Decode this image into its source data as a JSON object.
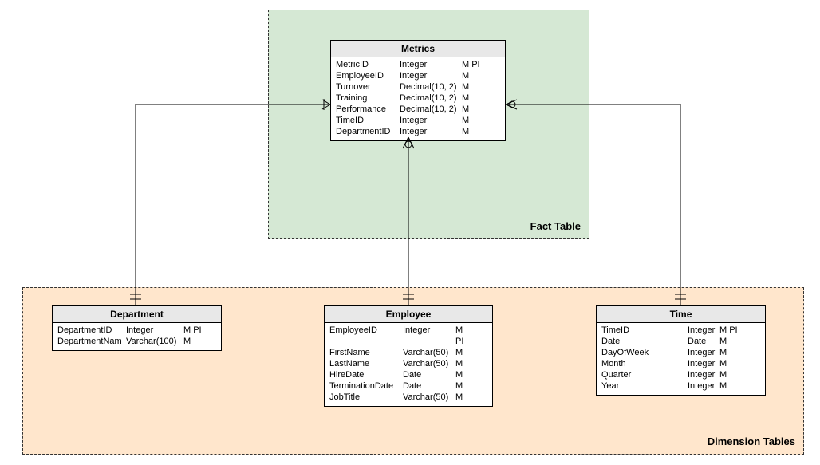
{
  "containers": {
    "fact": {
      "label": "Fact Table"
    },
    "dim": {
      "label": "Dimension Tables"
    }
  },
  "tables": {
    "metrics": {
      "title": "Metrics",
      "rows": [
        {
          "name": "MetricID",
          "type": "Integer",
          "flags": "M PI"
        },
        {
          "name": "EmployeeID",
          "type": "Integer",
          "flags": "M"
        },
        {
          "name": "Turnover",
          "type": "Decimal(10, 2)",
          "flags": "M"
        },
        {
          "name": "Training",
          "type": "Decimal(10, 2)",
          "flags": "M"
        },
        {
          "name": "Performance",
          "type": "Decimal(10, 2)",
          "flags": "M"
        },
        {
          "name": "TimeID",
          "type": "Integer",
          "flags": "M"
        },
        {
          "name": "DepartmentID",
          "type": "Integer",
          "flags": "M"
        }
      ]
    },
    "department": {
      "title": "Department",
      "rows": [
        {
          "name": "DepartmentID",
          "type": "Integer",
          "flags": "M PI"
        },
        {
          "name": "DepartmentNam",
          "type": "Varchar(100)",
          "flags": "M"
        }
      ]
    },
    "employee": {
      "title": "Employee",
      "rows": [
        {
          "name": "EmployeeID",
          "type": "Integer",
          "flags": "M PI"
        },
        {
          "name": "FirstName",
          "type": "Varchar(50)",
          "flags": "M"
        },
        {
          "name": "LastName",
          "type": "Varchar(50)",
          "flags": "M"
        },
        {
          "name": "HireDate",
          "type": "Date",
          "flags": "M"
        },
        {
          "name": "TerminationDate",
          "type": "Date",
          "flags": "M"
        },
        {
          "name": "JobTitle",
          "type": "Varchar(50)",
          "flags": "M"
        }
      ]
    },
    "time": {
      "title": "Time",
      "rows": [
        {
          "name": "TimeID",
          "type": "Integer",
          "flags": "M PI"
        },
        {
          "name": "Date",
          "type": "Date",
          "flags": "M"
        },
        {
          "name": "DayOfWeek",
          "type": "Integer",
          "flags": "M"
        },
        {
          "name": "Month",
          "type": "Integer",
          "flags": "M"
        },
        {
          "name": "Quarter",
          "type": "Integer",
          "flags": "M"
        },
        {
          "name": "Year",
          "type": "Integer",
          "flags": "M"
        }
      ]
    }
  }
}
